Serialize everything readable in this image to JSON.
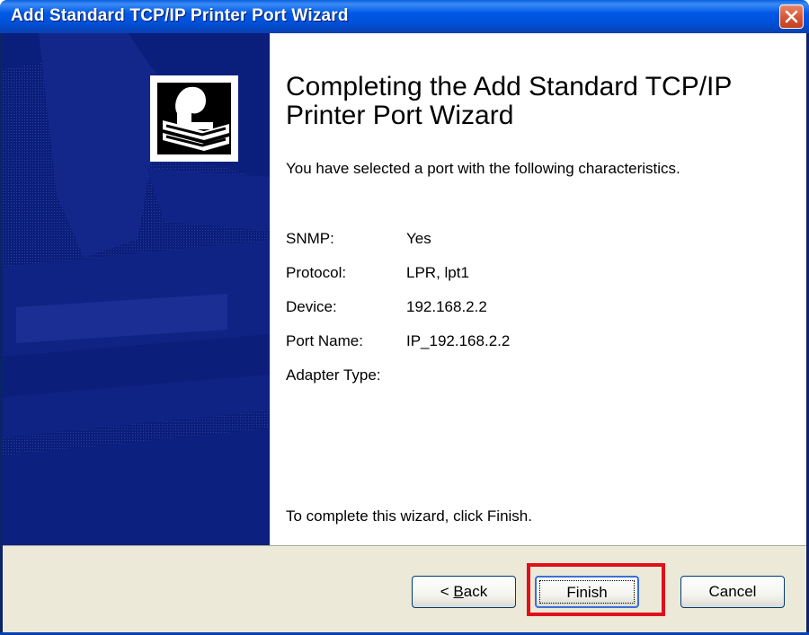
{
  "window": {
    "title": "Add Standard TCP/IP Printer Port Wizard",
    "close_icon": "close-icon"
  },
  "sidebar": {
    "logo_icon": "printer-wizard-icon",
    "color": "#0a1e7c"
  },
  "main": {
    "heading": "Completing the Add Standard TCP/IP Printer Port Wizard",
    "intro": "You have selected a port with the following characteristics.",
    "details": [
      {
        "label": "SNMP:",
        "value": "Yes"
      },
      {
        "label": "Protocol:",
        "value": "LPR, lpt1"
      },
      {
        "label": "Device:",
        "value": "192.168.2.2"
      },
      {
        "label": "Port Name:",
        "value": "IP_192.168.2.2"
      },
      {
        "label": "Adapter Type:",
        "value": ""
      }
    ],
    "finish_note": "To complete this wizard, click Finish."
  },
  "footer": {
    "back_label_prefix": "< ",
    "back_label_accel": "B",
    "back_label_rest": "ack",
    "finish_label": "Finish",
    "cancel_label": "Cancel"
  },
  "colors": {
    "titlebar": "#0058e6",
    "highlight": "#e0101b",
    "footer": "#ece9d8"
  }
}
